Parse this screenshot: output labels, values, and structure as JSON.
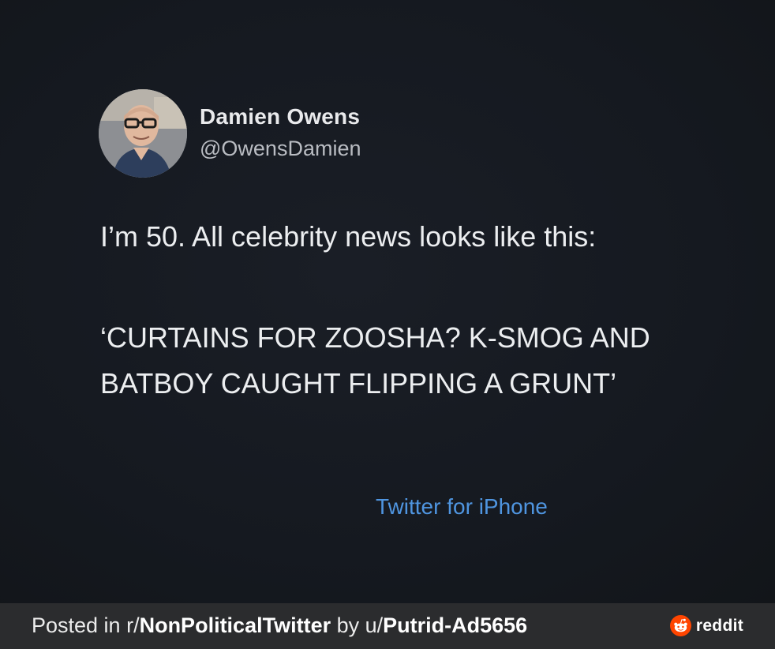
{
  "tweet": {
    "author_name": "Damien Owens",
    "author_handle": "@OwensDamien",
    "text_line_1": "I’m 50. All celebrity news looks like this:",
    "text_line_2": "‘CURTAINS FOR ZOOSHA? K-SMOG AND BATBOY CAUGHT FLIPPING A GRUNT’",
    "source": "Twitter for iPhone"
  },
  "footer": {
    "posted_in_label": "Posted in ",
    "subreddit_prefix": "r/",
    "subreddit": "NonPoliticalTwitter",
    "by_label": " by ",
    "user_prefix": "u/",
    "username": "Putrid-Ad5656",
    "brand": "reddit"
  },
  "icons": {
    "avatar": "profile-photo",
    "brand_icon": "reddit-logo-icon"
  },
  "colors": {
    "background": "#161a22",
    "source_link": "#4f95e0",
    "footer_bg": "#2b2c2e",
    "reddit_orange": "#ff4500"
  }
}
